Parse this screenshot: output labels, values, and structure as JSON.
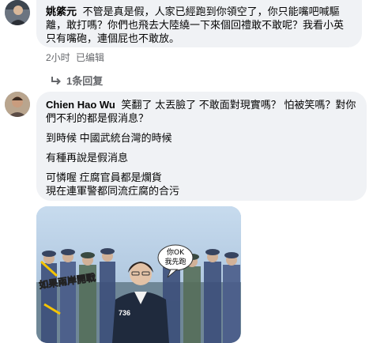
{
  "comments": [
    {
      "author": "姚綮元",
      "text": "不管是真是假，人家已經跑到你領空了，你只能嘴吧喊驅離，敢打嗎？你們也飛去大陸繞一下來個回禮敢不敢呢？我看小英只有嘴砲，連個屁也不敢放。",
      "time": "2小时",
      "edited": "已编辑",
      "replies_label": "1条回复"
    },
    {
      "author": "Chien Hao Wu",
      "first_line": "笑翻了 太丟臉了 不敢面對現實嗎？ 怕被笑嗎？對你們不利的都是假消息？",
      "paragraphs": [
        "到時候 中國武統台灣的時候",
        "有種再說是假消息",
        "可憐喔 疘腐官員都是爛貨\n現在連軍警都同流疘腐的合污"
      ]
    }
  ],
  "image": {
    "caption_left": "如果兩岸開戰",
    "speech_bubble": "你OK\n我先跑",
    "jacket_text": "736"
  }
}
